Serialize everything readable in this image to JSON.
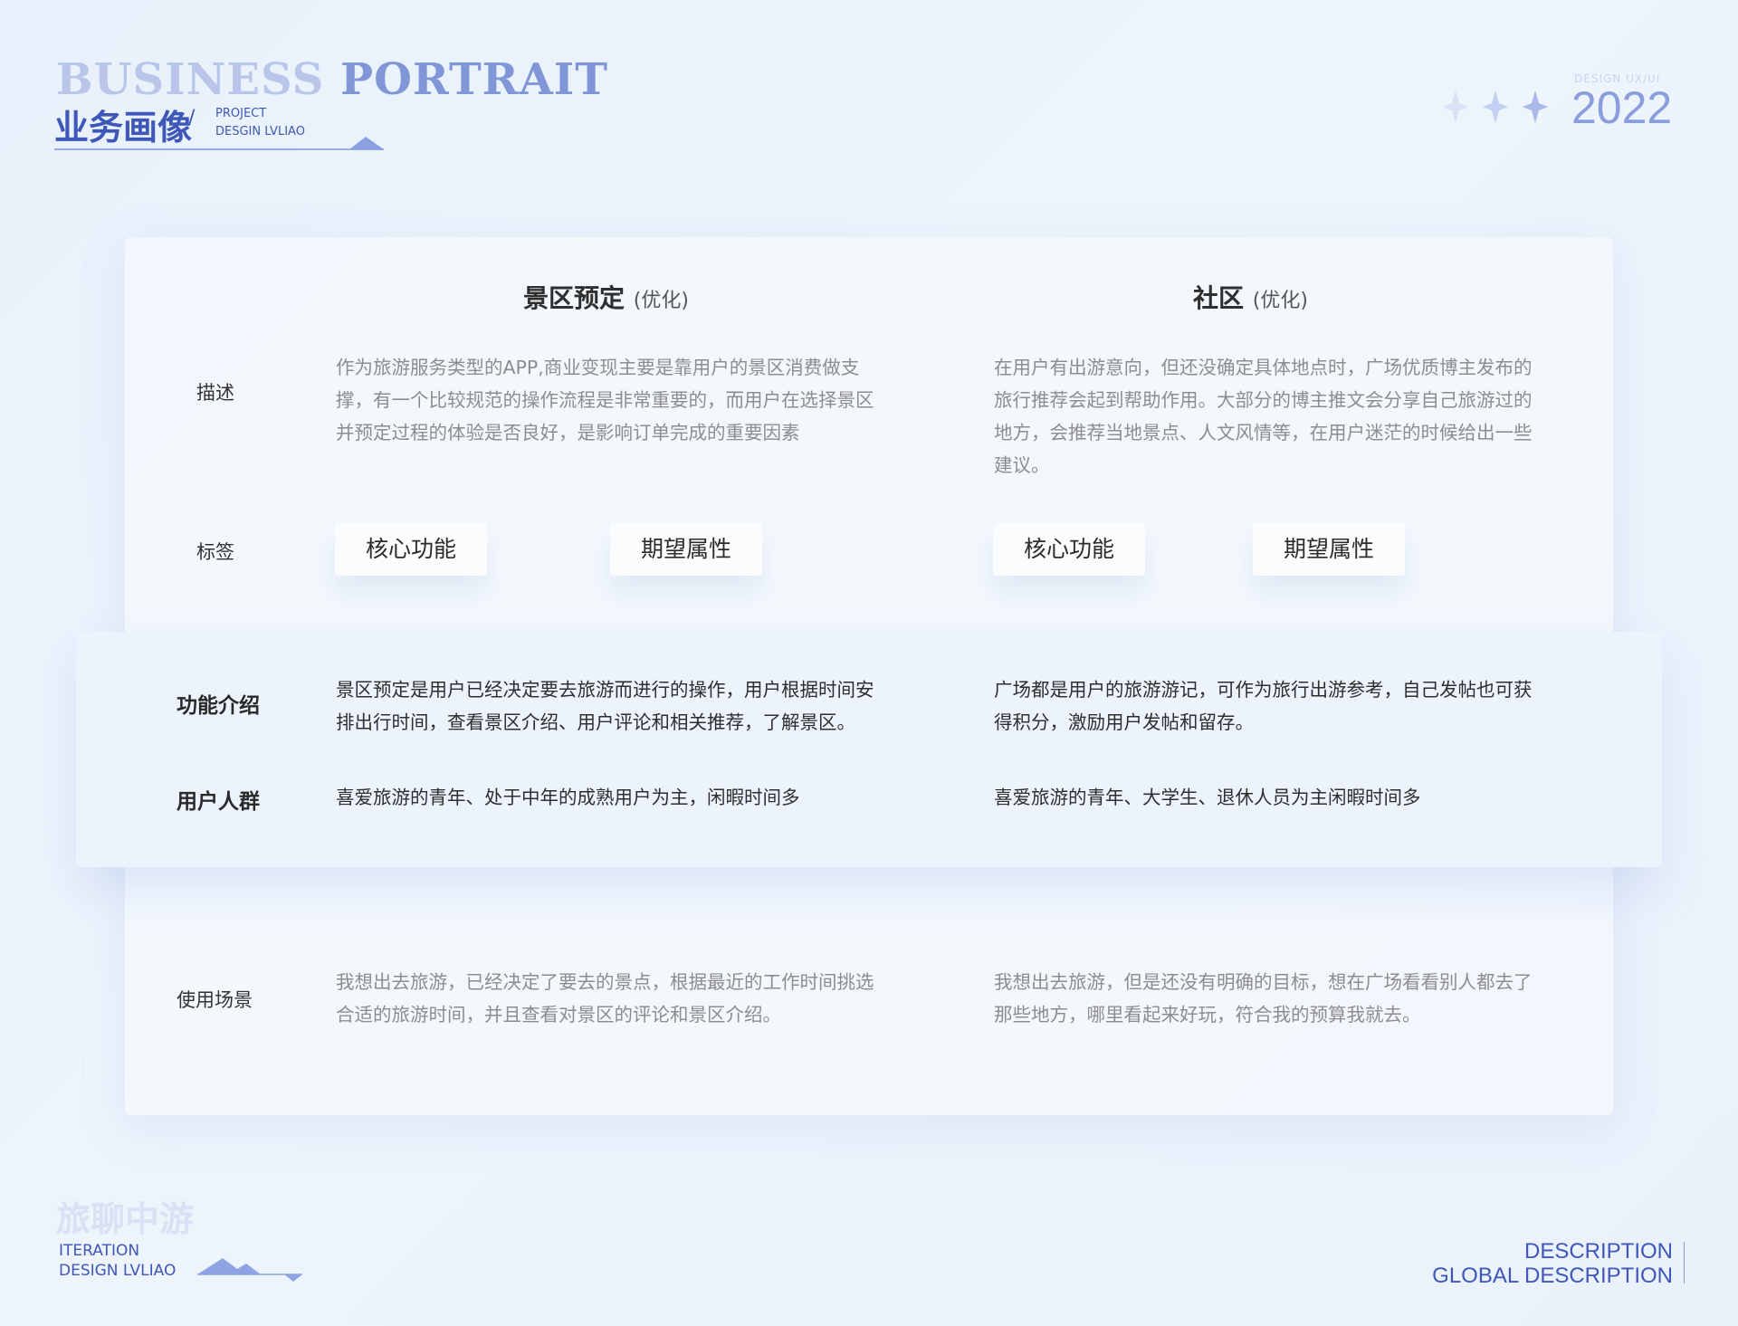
{
  "header": {
    "title_en_1": "BUSINESS",
    "title_en_2": "PORTRAIT",
    "title_cn": "业务画像",
    "slash": "/",
    "project_line1": "PROJECT",
    "project_line2": "DESGIN LVLIAO",
    "design_small": "DESIGN   UX/UI",
    "year": "2022"
  },
  "columns": [
    {
      "title": "景区预定",
      "suffix": "(优化)"
    },
    {
      "title": "社区",
      "suffix": "(优化)"
    }
  ],
  "rows": {
    "description": {
      "label": "描述",
      "left": "作为旅游服务类型的APP,商业变现主要是靠用户的景区消费做支撑，有一个比较规范的操作流程是非常重要的，而用户在选择景区并预定过程的体验是否良好，是影响订单完成的重要因素",
      "right": "在用户有出游意向，但还没确定具体地点时，广场优质博主发布的旅行推荐会起到帮助作用。大部分的博主推文会分享自己旅游过的地方，会推荐当地景点、人文风情等，在用户迷茫的时候给出一些建议。"
    },
    "tags": {
      "label": "标签",
      "left": [
        "核心功能",
        "期望属性"
      ],
      "right": [
        "核心功能",
        "期望属性"
      ]
    },
    "features": {
      "label": "功能介绍",
      "left": "景区预定是用户已经决定要去旅游而进行的操作，用户根据时间安排出行时间，查看景区介绍、用户评论和相关推荐，了解景区。",
      "right": "广场都是用户的旅游游记，可作为旅行出游参考，自己发帖也可获得积分，激励用户发帖和留存。"
    },
    "audience": {
      "label": "用户人群",
      "left": "喜爱旅游的青年、处于中年的成熟用户为主，闲暇时间多",
      "right": "喜爱旅游的青年、大学生、退休人员为主闲暇时间多"
    },
    "scenario": {
      "label": "使用场景",
      "left": "我想出去旅游，已经决定了要去的景点，根据最近的工作时间挑选合适的旅游时间，并且查看对景区的评论和景区介绍。",
      "right": "我想出去旅游，但是还没有明确的目标，想在广场看看别人都去了那些地方，哪里看起来好玩，符合我的预算我就去。"
    }
  },
  "footer": {
    "watermark": "旅聊中游",
    "iteration": "ITERATION",
    "design": "DESIGN   LVLIAO",
    "desc1": "DESCRIPTION",
    "desc2": "GLOBAL DESCRIPTION"
  },
  "colors": {
    "accent": "#3e57b8",
    "accent_light": "#8196d6",
    "card": "#f3f7fd",
    "band": "#edf3fd"
  }
}
